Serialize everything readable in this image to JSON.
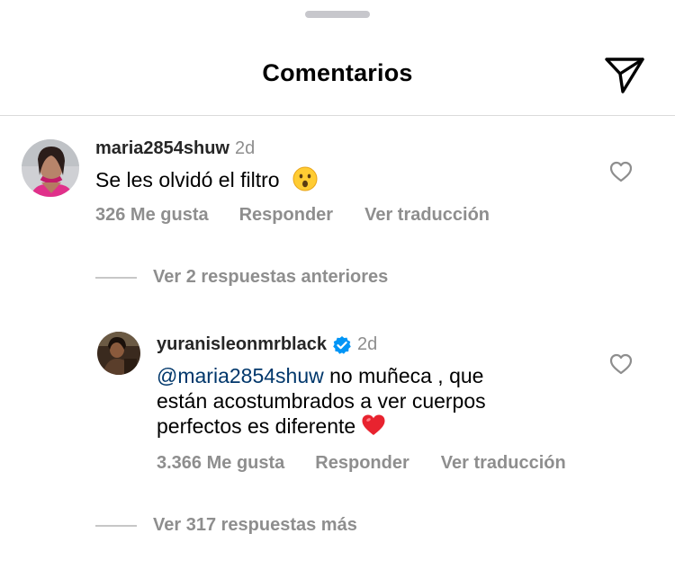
{
  "header": {
    "title": "Comentarios",
    "send_icon": "paper-plane-icon"
  },
  "comments": [
    {
      "username": "maria2854shuw",
      "time": "2d",
      "text": "Se les olvidó el filtro",
      "emoji": "hushed-face",
      "likes": "326 Me gusta",
      "reply_label": "Responder",
      "translate_label": "Ver traducción"
    }
  ],
  "view_previous_replies": "Ver 2 respuestas anteriores",
  "reply": {
    "username": "yuranisleonmrblack",
    "verified": true,
    "time": "2d",
    "mention": "@maria2854shuw",
    "text_line1": " no muñeca , que",
    "text_line2": "están acostumbrados a ver cuerpos",
    "text_line3": "perfectos es diferente",
    "emoji": "red-heart",
    "likes": "3.366 Me gusta",
    "reply_label": "Responder",
    "translate_label": "Ver traducción"
  },
  "view_more_replies": "Ver 317 respuestas más",
  "colors": {
    "secondary_text": "#8e8e8e",
    "mention": "#00376b",
    "verified_badge": "#0095f6",
    "divider": "#dbdbdb"
  }
}
